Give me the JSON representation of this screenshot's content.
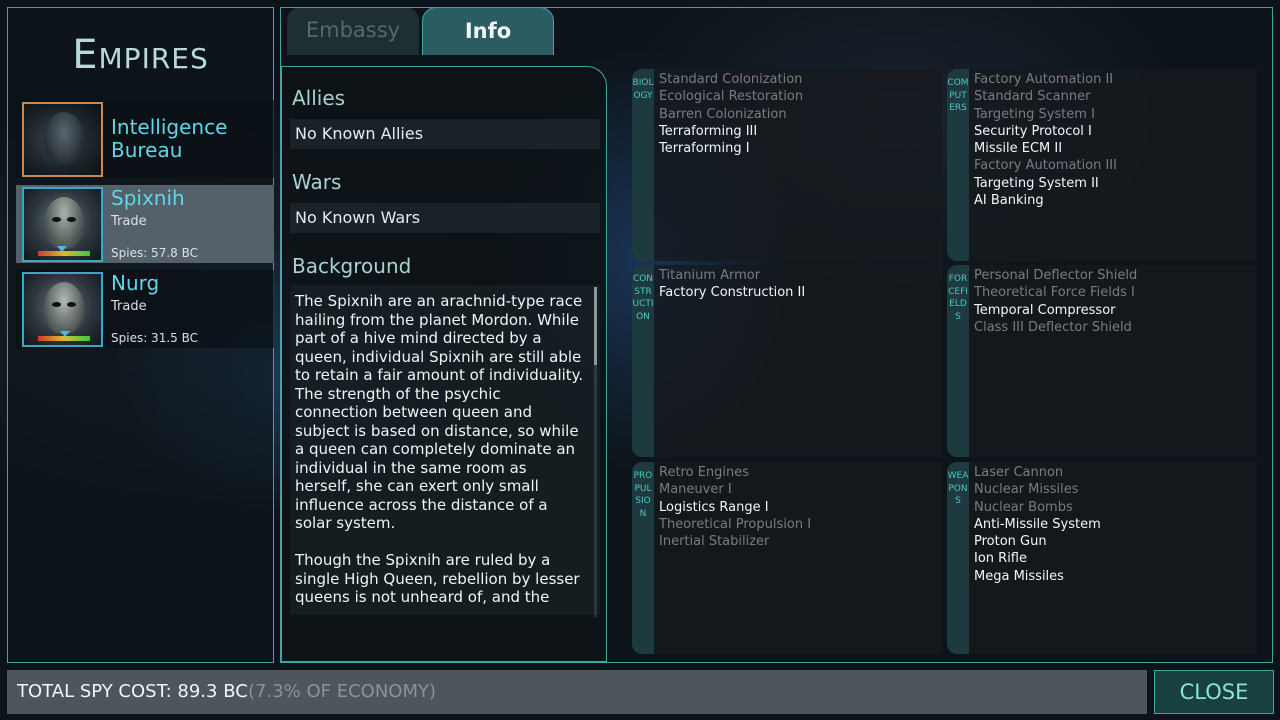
{
  "empires_panel": {
    "title": "Empires",
    "empires": [
      {
        "name": "Intelligence Bureau",
        "status": "",
        "spies": ""
      },
      {
        "name": "Spixnih",
        "status": "Trade",
        "spies": "Spies: 57.8 BC"
      },
      {
        "name": "Nurg",
        "status": "Trade",
        "spies": "Spies: 31.5 BC"
      }
    ]
  },
  "tabs": {
    "embassy": "Embassy",
    "info": "Info"
  },
  "info": {
    "allies_heading": "Allies",
    "allies_value": "No Known Allies",
    "wars_heading": "Wars",
    "wars_value": "No Known Wars",
    "background_heading": "Background",
    "background_text": "The Spixnih are an arachnid-type race hailing from the planet Mordon. While part of a hive mind directed by a queen, individual Spixnih are still able to retain a fair amount of individuality. The strength of the psychic connection between queen and subject is based on distance, so while a queen can completely dominate an individual in the same room as herself, she can exert only small influence across the distance of a solar system.\n\nThough the Spixnih are ruled by a single High Queen, rebellion by lesser queens is not unheard of, and the"
  },
  "tech": {
    "biology": {
      "label": "BIOLOGY",
      "items": [
        {
          "name": "Standard Colonization",
          "known": false
        },
        {
          "name": "Ecological Restoration",
          "known": false
        },
        {
          "name": "Barren Colonization",
          "known": false
        },
        {
          "name": "Terraforming III",
          "known": true
        },
        {
          "name": "Terraforming I",
          "known": true
        }
      ]
    },
    "computers": {
      "label": "COMPUTERS",
      "items": [
        {
          "name": "Factory Automation II",
          "known": false
        },
        {
          "name": "Standard Scanner",
          "known": false
        },
        {
          "name": "Targeting System I",
          "known": false
        },
        {
          "name": "Security Protocol I",
          "known": true
        },
        {
          "name": "Missile ECM II",
          "known": true
        },
        {
          "name": "Factory Automation III",
          "known": false
        },
        {
          "name": "Targeting System II",
          "known": true
        },
        {
          "name": "AI Banking",
          "known": true
        }
      ]
    },
    "construction": {
      "label": "CONSTRUCTION",
      "items": [
        {
          "name": "Titanium Armor",
          "known": false
        },
        {
          "name": "Factory Construction II",
          "known": true
        }
      ]
    },
    "forcefields": {
      "label": "FORCEFIELDS",
      "items": [
        {
          "name": "Personal Deflector Shield",
          "known": false
        },
        {
          "name": "Theoretical Force Fields I",
          "known": false
        },
        {
          "name": "Temporal Compressor",
          "known": true
        },
        {
          "name": "Class III Deflector Shield",
          "known": false
        }
      ]
    },
    "propulsion": {
      "label": "PROPULSION",
      "items": [
        {
          "name": "Retro Engines",
          "known": false
        },
        {
          "name": "Maneuver I",
          "known": false
        },
        {
          "name": "Logistics Range I",
          "known": true
        },
        {
          "name": "Theoretical Propulsion I",
          "known": false
        },
        {
          "name": "Inertial Stabilizer",
          "known": false
        }
      ]
    },
    "weapons": {
      "label": "WEAPONS",
      "items": [
        {
          "name": "Laser Cannon",
          "known": false
        },
        {
          "name": "Nuclear Missiles",
          "known": false
        },
        {
          "name": "Nuclear Bombs",
          "known": false
        },
        {
          "name": "Anti-Missile System",
          "known": true
        },
        {
          "name": "Proton Gun",
          "known": true
        },
        {
          "name": "Ion Rifle",
          "known": true
        },
        {
          "name": "Mega Missiles",
          "known": true
        }
      ]
    }
  },
  "footer": {
    "cost_label": "TOTAL SPY COST: 89.3 BC",
    "cost_percent": "(7.3% OF ECONOMY)",
    "close_label": "CLOSE"
  }
}
